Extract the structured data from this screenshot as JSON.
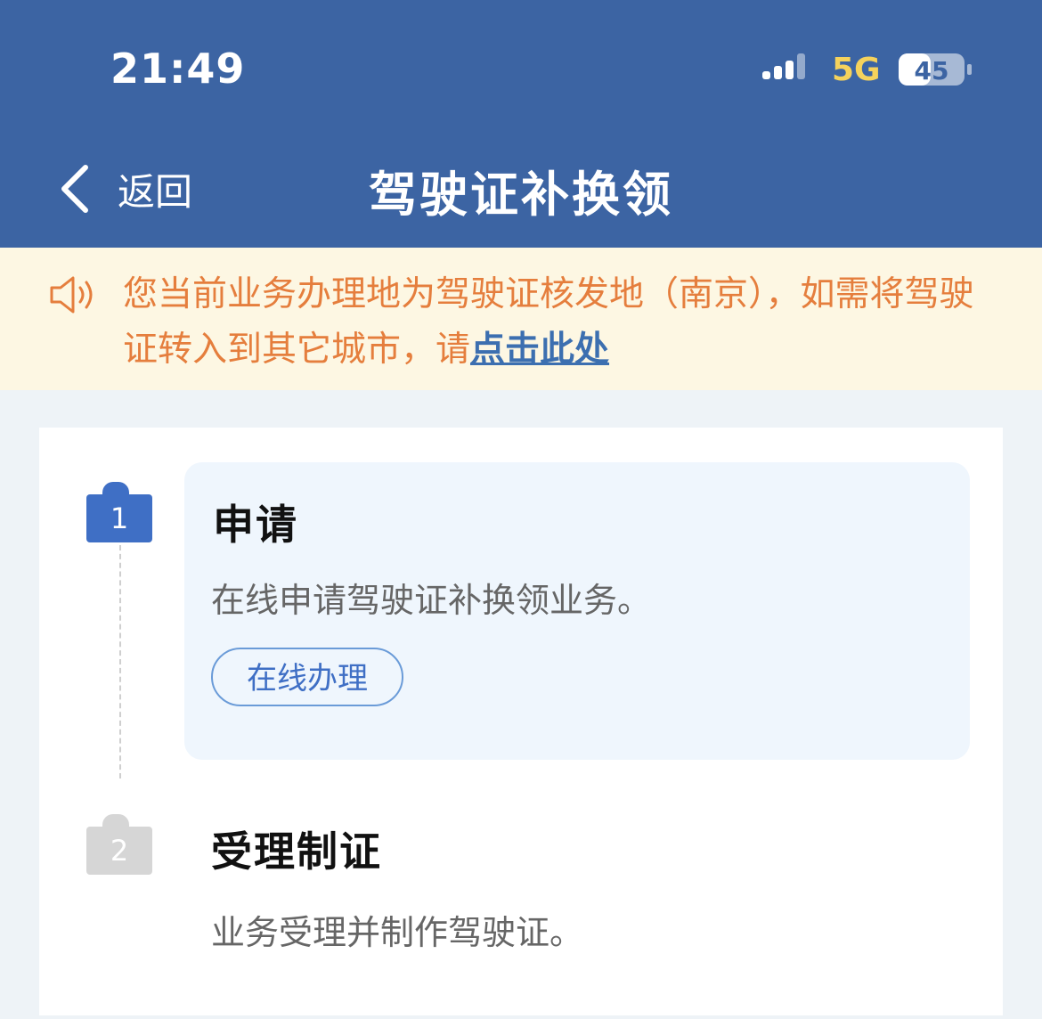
{
  "status_bar": {
    "time": "21:49",
    "network": "5G",
    "battery": "45"
  },
  "nav": {
    "back_label": "返回",
    "title": "驾驶证补换领"
  },
  "notice": {
    "text": "您当前业务办理地为驾驶证核发地（南京），如需将驾驶证转入到其它城市，请",
    "link": "点击此处"
  },
  "steps": [
    {
      "number": "1",
      "title": "申请",
      "description": "在线申请驾驶证补换领业务。",
      "action": "在线办理"
    },
    {
      "number": "2",
      "title": "受理制证",
      "description": "业务受理并制作驾驶证。"
    }
  ],
  "icons": {
    "back": "chevron-left-icon",
    "notice": "speaker-icon",
    "signal": "signal-icon",
    "battery": "battery-icon"
  },
  "colors": {
    "header": "#3c64a3",
    "notice_bg": "#fdf7e3",
    "notice_text": "#e57e3d",
    "link": "#3c6fb0",
    "step_active": "#3f6fc5",
    "step_inactive": "#d6d6d6"
  }
}
